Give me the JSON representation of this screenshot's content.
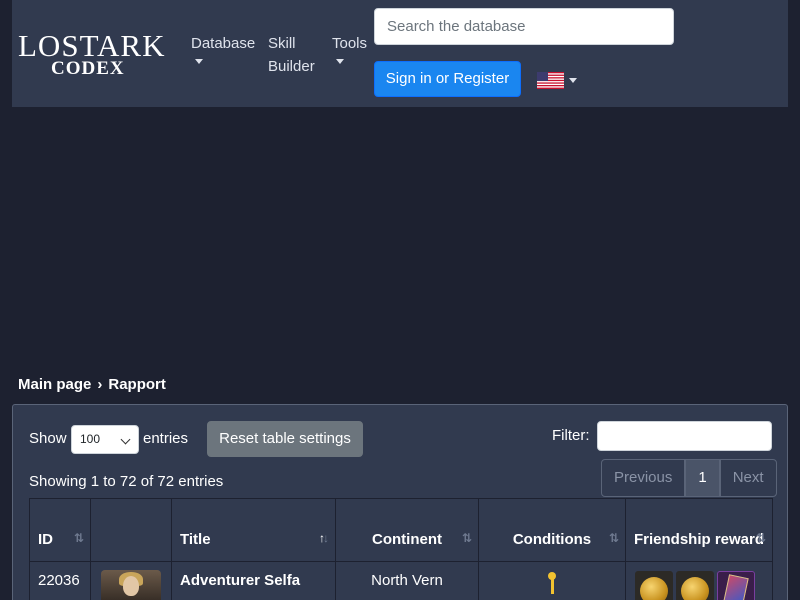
{
  "header": {
    "logo_top": "LOSTARK",
    "logo_bottom": "CODEX",
    "nav": [
      {
        "label": "Database"
      },
      {
        "label": "Skill\nBuilder"
      },
      {
        "label": "Tools"
      }
    ],
    "search_placeholder": "Search the database",
    "signin_label": "Sign in or Register",
    "language_icon": "us-flag-icon"
  },
  "breadcrumb": {
    "items": [
      "Main page",
      "Rapport"
    ],
    "separator": "›"
  },
  "controls": {
    "show_label": "Show",
    "entries_value": "100",
    "entries_label": "entries",
    "reset_label": "Reset table settings",
    "filter_label": "Filter:",
    "filter_value": "",
    "info": "Showing 1 to 72 of 72 entries"
  },
  "pagination": {
    "previous": "Previous",
    "current": "1",
    "next": "Next"
  },
  "table": {
    "columns": [
      "ID",
      "",
      "Title",
      "Continent",
      "Conditions",
      "Friendship reward"
    ],
    "sort_icon": "⇅",
    "rows": [
      {
        "id": "22036",
        "title": "Adventurer Selfa",
        "continent": "North Vern",
        "condition_icon": "key-icon",
        "rewards": [
          "gold-coin-icon",
          "gold-coin-icon",
          "card-icon"
        ]
      }
    ]
  },
  "colors": {
    "background": "#1d2130",
    "header_bg": "#313a4f",
    "primary_button": "#1a86f0",
    "secondary_button": "#6c757d"
  }
}
